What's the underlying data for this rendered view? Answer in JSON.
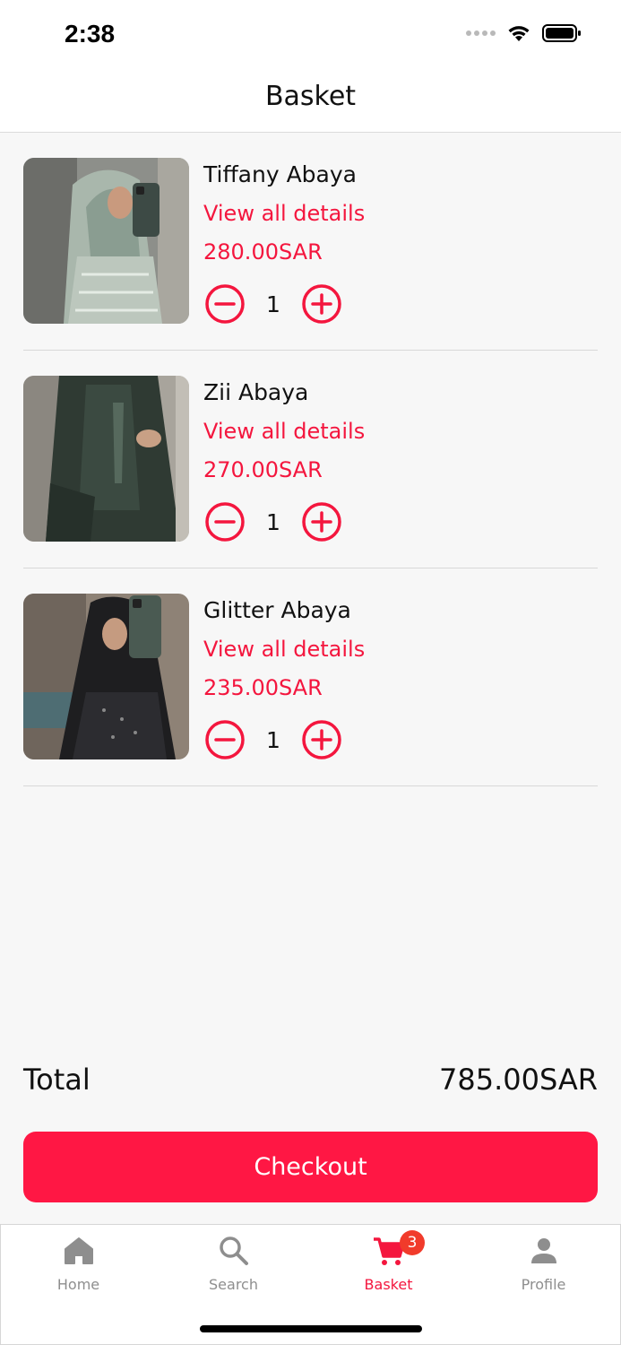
{
  "status_bar": {
    "time": "2:38"
  },
  "header": {
    "title": "Basket"
  },
  "items": [
    {
      "name": "Tiffany Abaya",
      "details_label": "View all details",
      "price": "280.00SAR",
      "quantity": "1"
    },
    {
      "name": "Zii Abaya",
      "details_label": "View all details",
      "price": "270.00SAR",
      "quantity": "1"
    },
    {
      "name": "Glitter Abaya",
      "details_label": "View all details",
      "price": "235.00SAR",
      "quantity": "1"
    }
  ],
  "summary": {
    "total_label": "Total",
    "total_value": "785.00SAR"
  },
  "checkout": {
    "label": "Checkout"
  },
  "tabbar": {
    "tabs": [
      {
        "label": "Home",
        "icon": "home-icon"
      },
      {
        "label": "Search",
        "icon": "search-icon"
      },
      {
        "label": "Basket",
        "icon": "cart-icon",
        "badge": "3",
        "active": true
      },
      {
        "label": "Profile",
        "icon": "person-icon"
      }
    ]
  },
  "colors": {
    "accent": "#f4163e",
    "checkout_bg": "#ff1744",
    "badge": "#f13b2b",
    "inactive": "#8e8e8e"
  }
}
